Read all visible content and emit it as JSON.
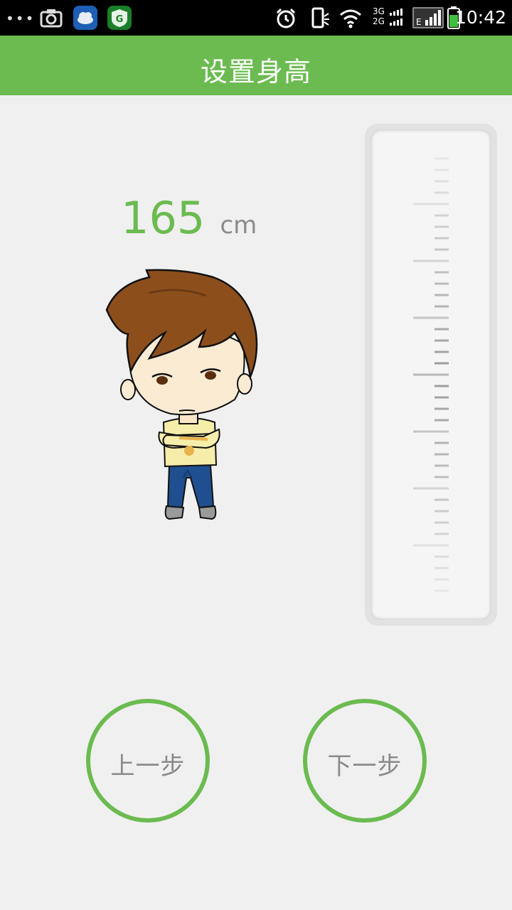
{
  "status_bar": {
    "time": "10:42",
    "network_top": "3G",
    "network_bottom": "2G",
    "signal_label": "E",
    "notification_icons": [
      "more-icon",
      "camera-icon",
      "cloud-app-icon",
      "shield-app-icon"
    ],
    "system_icons": [
      "alarm-icon",
      "vibrate-icon",
      "wifi-icon",
      "signal-icon",
      "battery-icon"
    ]
  },
  "header": {
    "title": "设置身高"
  },
  "height": {
    "value": "165",
    "unit": "cm"
  },
  "buttons": {
    "prev_label": "上一步",
    "next_label": "下一步"
  },
  "colors": {
    "accent": "#6bbb50",
    "label_gray": "#8a8a8a",
    "background": "#f0f0f0"
  }
}
